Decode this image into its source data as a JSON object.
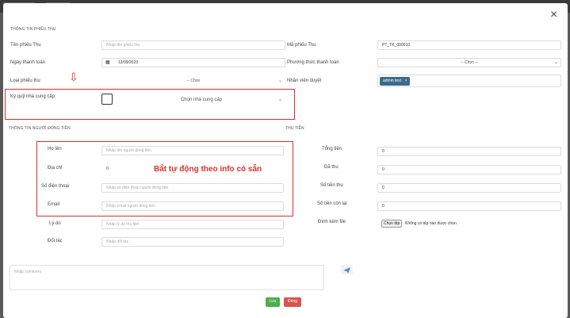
{
  "section_receipt_info": "THÔNG TIN PHIẾU THU",
  "section_payer_info": "THÔNG TIN NGƯỜI ĐÓNG TIỀN",
  "section_money": "THU TIỀN",
  "close_glyph": "×",
  "fields": {
    "receipt_name": {
      "label": "Tên phiếu Thu",
      "placeholder": "Nhập tên phiếu thu"
    },
    "receipt_code": {
      "label": "Mã phiếu Thu",
      "value": "PT_TK_000010"
    },
    "payment_date": {
      "label": "Ngày thanh toán",
      "value": "12/09/2023"
    },
    "payment_method": {
      "label": "Phương thức thanh toán",
      "value": "-- Chọn --"
    },
    "receipt_type": {
      "label": "Loại phiếu thu",
      "value": "-- Chọn"
    },
    "approver": {
      "label": "Nhân viên duyệt",
      "tag": "admin test",
      "tag_close": "×"
    },
    "supplier_deposit": {
      "label": "Ký quỹ nhà cung cấp",
      "value": "Chọn nhà cung cấp"
    },
    "full_name": {
      "label": "Họ tên",
      "placeholder": "Nhập tên người đóng tiền"
    },
    "address": {
      "label": "Địa chỉ",
      "value": "0"
    },
    "phone": {
      "label": "Số điện thoại",
      "placeholder": "Nhập số điện thoại người đóng tiền"
    },
    "email": {
      "label": "Email",
      "placeholder": "Nhập email người đóng tiền"
    },
    "reason": {
      "label": "Lý do",
      "placeholder": "Nhập lý do thu tiền"
    },
    "partner": {
      "label": "Đối tác",
      "placeholder": "Nhập đối tác"
    },
    "total": {
      "label": "Tổng tiền",
      "value": "0"
    },
    "collected": {
      "label": "Đã thu",
      "value": "0"
    },
    "amount": {
      "label": "Số tiền thu",
      "value": "0"
    },
    "remaining": {
      "label": "Số tiền còn lại",
      "value": "0"
    },
    "attachment": {
      "label": "Đính kèm file",
      "button": "Chọn tệp",
      "status": "Không có tệp nào được chọn"
    }
  },
  "annotation": "Bắt tự động theo info có sẵn",
  "arrow_glyph": "⇩",
  "comment": {
    "placeholder": "Nhập comment"
  },
  "buttons": {
    "save": "Lưu",
    "close": "Đóng"
  },
  "colors": {
    "annotation_red": "#d9302c",
    "save_green": "#4cae4c",
    "close_red": "#d9534f",
    "tag_blue": "#3a6b8c",
    "send_blue": "#3b8fd9"
  }
}
